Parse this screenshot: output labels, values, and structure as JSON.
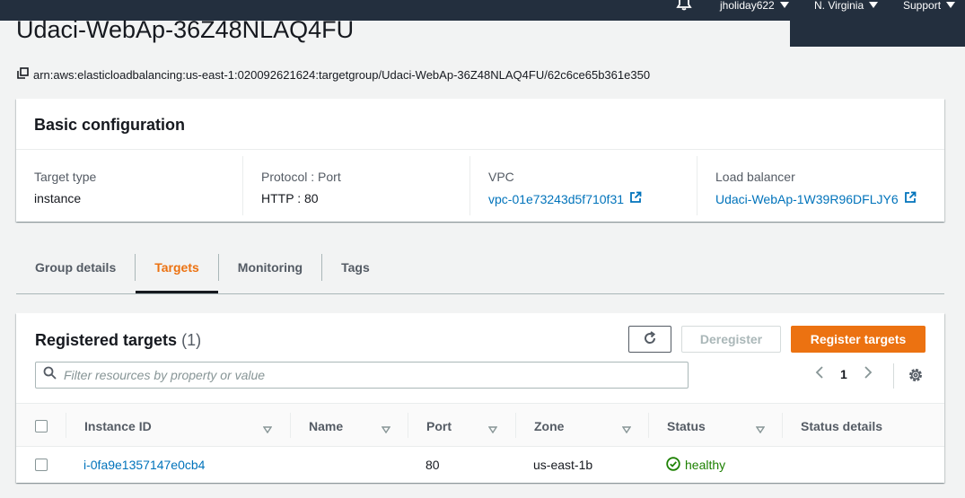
{
  "topnav": {
    "user": "jholiday622",
    "region": "N. Virginia",
    "support": "Support",
    "bell_icon": "bell-icon"
  },
  "page": {
    "title": "Udaci-WebAp-36Z48NLAQ4FU",
    "arn": "arn:aws:elasticloadbalancing:us-east-1:020092621624:targetgroup/Udaci-WebAp-36Z48NLAQ4FU/62c6ce65b361e350",
    "copy_icon": "copy-icon"
  },
  "basic_config": {
    "heading": "Basic configuration",
    "target_type_label": "Target type",
    "target_type": "instance",
    "protocol_label": "Protocol : Port",
    "protocol": "HTTP : 80",
    "vpc_label": "VPC",
    "vpc": "vpc-01e73243d5f710f31",
    "lb_label": "Load balancer",
    "lb": "Udaci-WebAp-1W39R96DFLJY6"
  },
  "tabs": [
    {
      "label": "Group details",
      "active": false
    },
    {
      "label": "Targets",
      "active": true
    },
    {
      "label": "Monitoring",
      "active": false
    },
    {
      "label": "Tags",
      "active": false
    }
  ],
  "targets": {
    "heading": "Registered targets",
    "count": "(1)",
    "deregister_label": "Deregister",
    "register_label": "Register targets",
    "filter_placeholder": "Filter resources by property or value",
    "page_number": "1",
    "columns": [
      "Instance ID",
      "Name",
      "Port",
      "Zone",
      "Status",
      "Status details"
    ],
    "rows": [
      {
        "instance_id": "i-0fa9e1357147e0cb4",
        "name": "",
        "port": "80",
        "zone": "us-east-1b",
        "status": "healthy",
        "status_details": ""
      }
    ]
  },
  "colors": {
    "nav_bg": "#232f3e",
    "accent_orange": "#ec7211",
    "link_blue": "#0073bb",
    "healthy_green": "#1d8102"
  }
}
